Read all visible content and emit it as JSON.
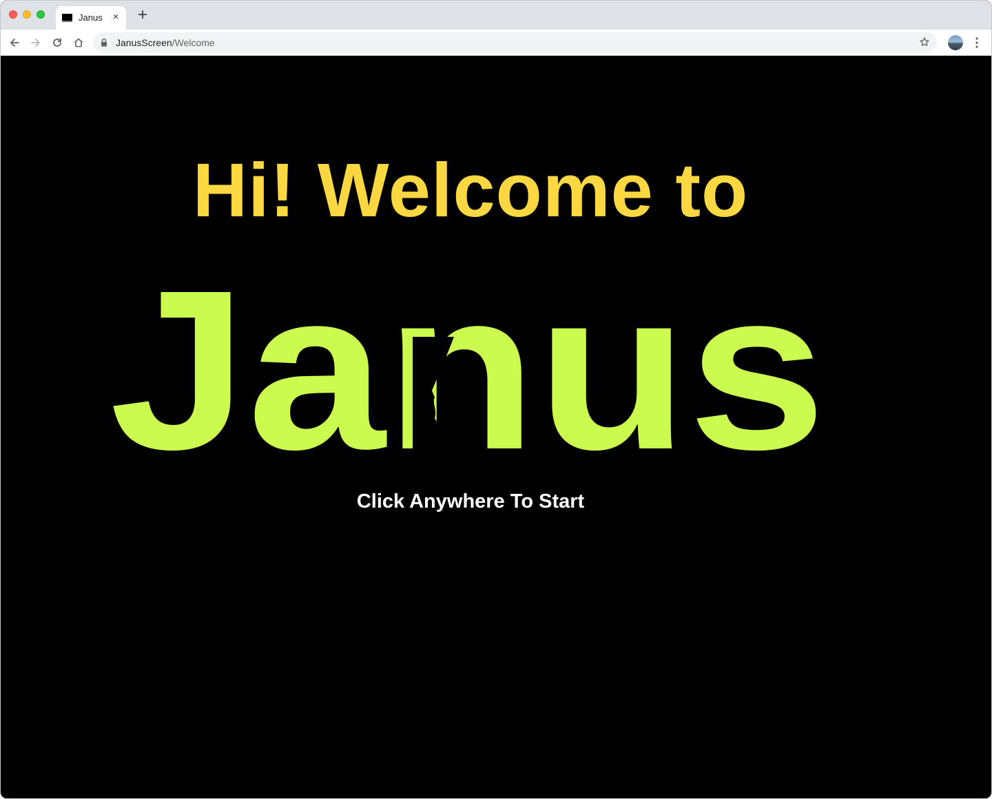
{
  "browser": {
    "tab_title": "Janus",
    "tab_close": "×",
    "new_tab": "+",
    "url_host": "JanusScreen",
    "url_path": "/Welcome"
  },
  "page": {
    "welcome_text": "Hi! Welcome to",
    "logo_text": "Janus",
    "cta_text": "Click Anywhere To Start"
  },
  "colors": {
    "welcome": "#fbd842",
    "logo": "#ccfb50",
    "background": "#000000",
    "cta": "#ffffff"
  }
}
